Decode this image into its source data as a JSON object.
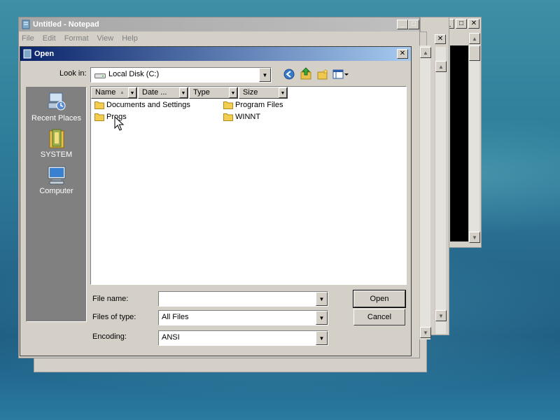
{
  "notepad": {
    "title": "Untitled - Notepad",
    "menus": [
      "File",
      "Edit",
      "Format",
      "View",
      "Help"
    ]
  },
  "dialog": {
    "title": "Open",
    "look_in_label": "Look in:",
    "look_in_value": "Local Disk (C:)",
    "places": [
      {
        "label": "Recent Places",
        "icon": "recent-places-icon"
      },
      {
        "label": "SYSTEM",
        "icon": "user-folder-icon"
      },
      {
        "label": "Computer",
        "icon": "computer-icon"
      }
    ],
    "columns": [
      "Name",
      "Date ...",
      "Type",
      "Size"
    ],
    "files_col1": [
      "Documents and Settings",
      "Progs"
    ],
    "files_col2": [
      "Program Files",
      "WINNT"
    ],
    "file_name_label": "File name:",
    "file_name_value": "",
    "files_of_type_label": "Files of type:",
    "files_of_type_value": "All Files",
    "encoding_label": "Encoding:",
    "encoding_value": "ANSI",
    "open_label": "Open",
    "cancel_label": "Cancel"
  },
  "colors": {
    "active_title_start": "#0a246a",
    "active_title_end": "#a6caf0",
    "inactive_title": "#a6a6a6",
    "window_face": "#d4d0c8",
    "places_bar": "#808080"
  }
}
